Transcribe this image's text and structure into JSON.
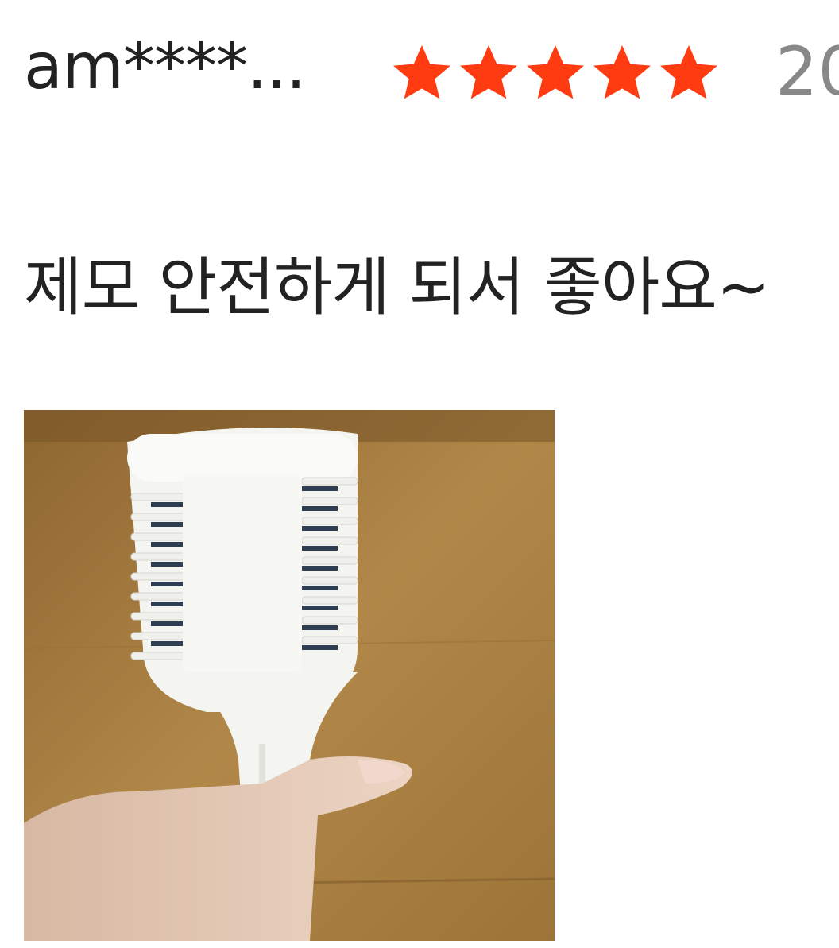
{
  "review": {
    "username": "am****...",
    "rating": 5,
    "rating_max": 5,
    "date": "20",
    "text": "제모 안전하게 되서 좋아요~"
  },
  "colors": {
    "star": "#ff3b12",
    "username": "#222222",
    "date": "#888888"
  },
  "icons": {
    "star": "star-icon"
  }
}
